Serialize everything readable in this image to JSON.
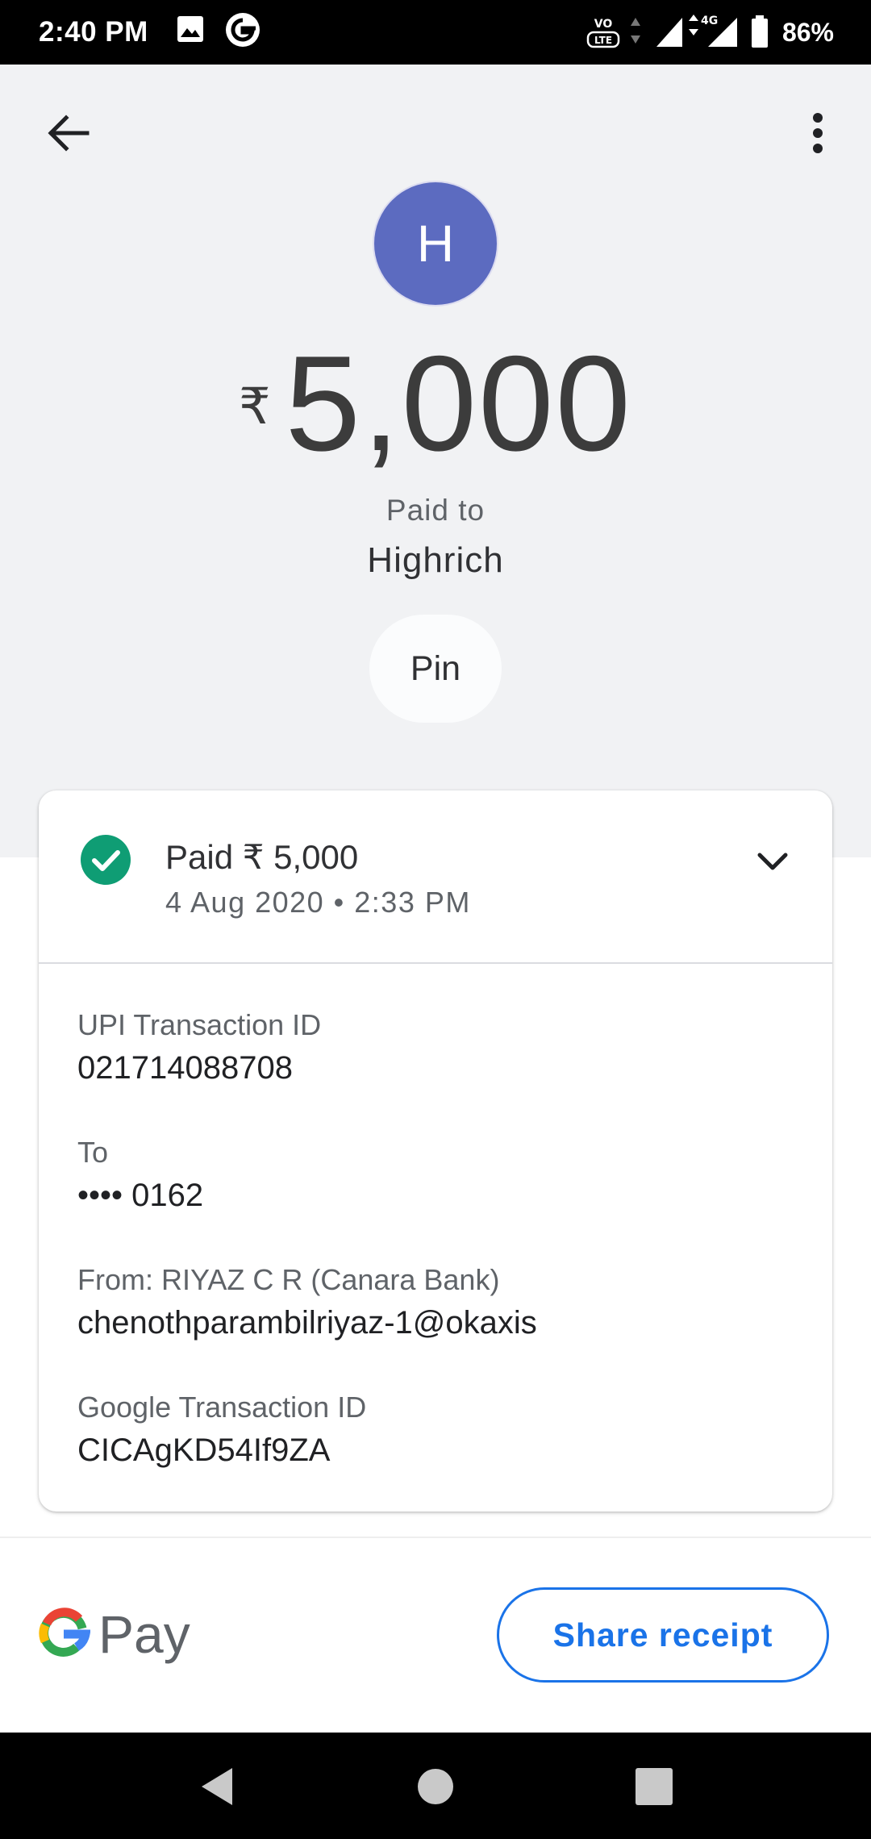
{
  "status_bar": {
    "time": "2:40 PM",
    "left_icons": [
      "image-icon",
      "google-g-icon"
    ],
    "right_icons": [
      "volte-icon",
      "data-arrows-icon",
      "signal-icon",
      "4g-signal-icon",
      "battery-icon"
    ],
    "network_label": "4G",
    "volte_label": "VoLTE",
    "battery": "86%"
  },
  "header": {
    "back_icon": "arrow-back-icon",
    "menu_icon": "more-vert-icon",
    "avatar_letter": "H",
    "avatar_color": "#5c6bc0",
    "currency_symbol": "₹",
    "amount": "5,000",
    "paid_to_label": "Paid to",
    "payee": "Highrich",
    "pin_label": "Pin"
  },
  "transaction": {
    "status_icon": "check-circle-icon",
    "status_color": "#0f9d74",
    "paid_line": "Paid ₹ 5,000",
    "date_time": "4 Aug 2020 • 2:33 PM",
    "expand_icon": "chevron-down-icon",
    "details": [
      {
        "label": "UPI Transaction ID",
        "value": "021714088708"
      },
      {
        "label": "To",
        "value": "•••• 0162"
      },
      {
        "label": "From: RIYAZ C R (Canara Bank)",
        "value": "chenothparambilriyaz-1@okaxis"
      },
      {
        "label": "Google Transaction ID",
        "value": "CICAgKD54If9ZA"
      }
    ]
  },
  "footer": {
    "brand_word": "Pay",
    "share_label": "Share receipt",
    "accent_color": "#1a73e8"
  },
  "nav_bar": {
    "icons": [
      "nav-back-icon",
      "nav-home-icon",
      "nav-recents-icon"
    ]
  }
}
